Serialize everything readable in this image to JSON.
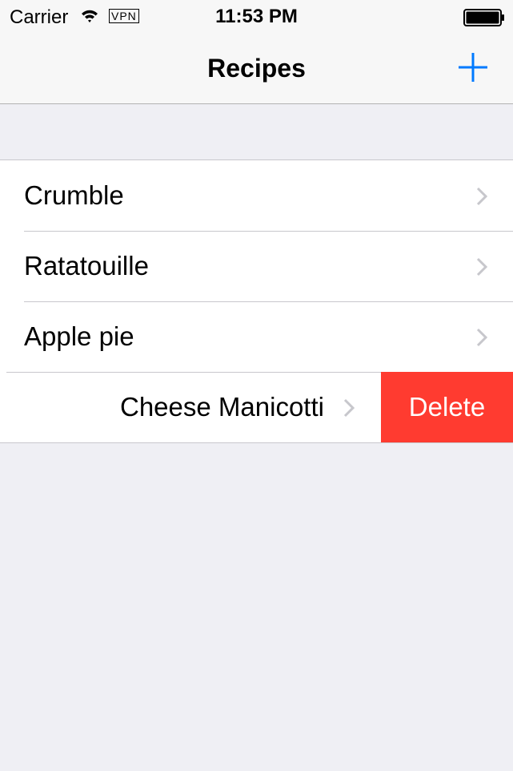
{
  "status_bar": {
    "carrier": "Carrier",
    "vpn": "VPN",
    "time": "11:53 PM"
  },
  "nav": {
    "title": "Recipes"
  },
  "recipes": [
    {
      "label": "Crumble"
    },
    {
      "label": "Ratatouille"
    },
    {
      "label": "Apple pie"
    },
    {
      "label": "Cheese Manicotti",
      "delete_label": "Delete"
    }
  ],
  "colors": {
    "tint": "#007aff",
    "delete": "#ff3b30",
    "background": "#efeff4"
  },
  "icons": [
    "wifi-icon",
    "battery-icon",
    "plus-icon",
    "chevron-right-icon"
  ]
}
